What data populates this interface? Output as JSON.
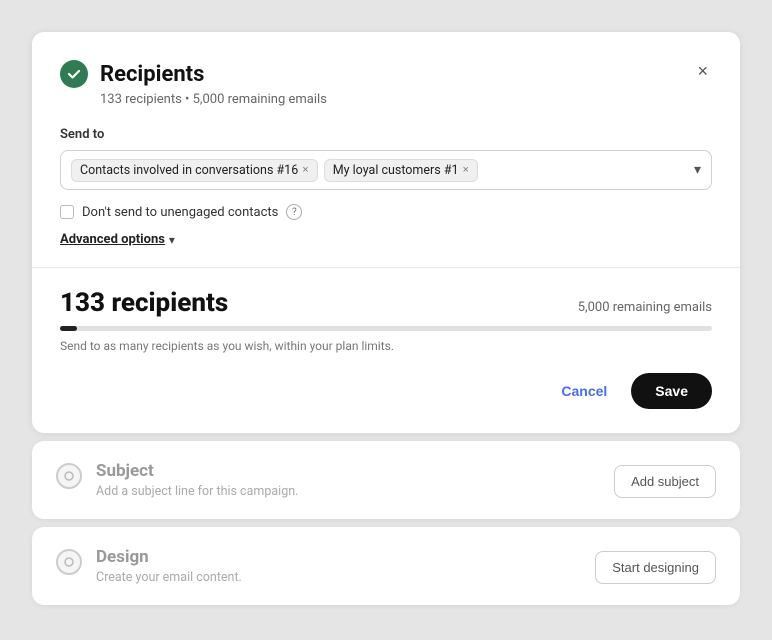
{
  "header": {
    "title": "Recipients",
    "subtitle": "133 recipients • 5,000 remaining emails",
    "close_label": "×"
  },
  "send_to": {
    "label": "Send to",
    "tags": [
      {
        "id": "tag-1",
        "text": "Contacts involved in conversations #16"
      },
      {
        "id": "tag-2",
        "text": "My loyal customers #1"
      }
    ],
    "dropdown_arrow": "▾"
  },
  "checkbox": {
    "label": "Don't send to unengaged contacts",
    "help_symbol": "?"
  },
  "advanced_options": {
    "label": "Advanced options",
    "arrow": "▾"
  },
  "recipients_section": {
    "count": "133 recipients",
    "remaining": "5,000 remaining emails",
    "progress_percent": 2.66,
    "hint": "Send to as many recipients as you wish, within your plan limits."
  },
  "actions": {
    "cancel_label": "Cancel",
    "save_label": "Save"
  },
  "subject_card": {
    "title": "Subject",
    "description": "Add a subject line for this campaign.",
    "action_label": "Add subject"
  },
  "design_card": {
    "title": "Design",
    "description": "Create your email content.",
    "action_label": "Start designing"
  },
  "colors": {
    "accent_green": "#2e7d52",
    "accent_blue": "#4a6cf7",
    "progress_fill_pct": "2.66%"
  }
}
